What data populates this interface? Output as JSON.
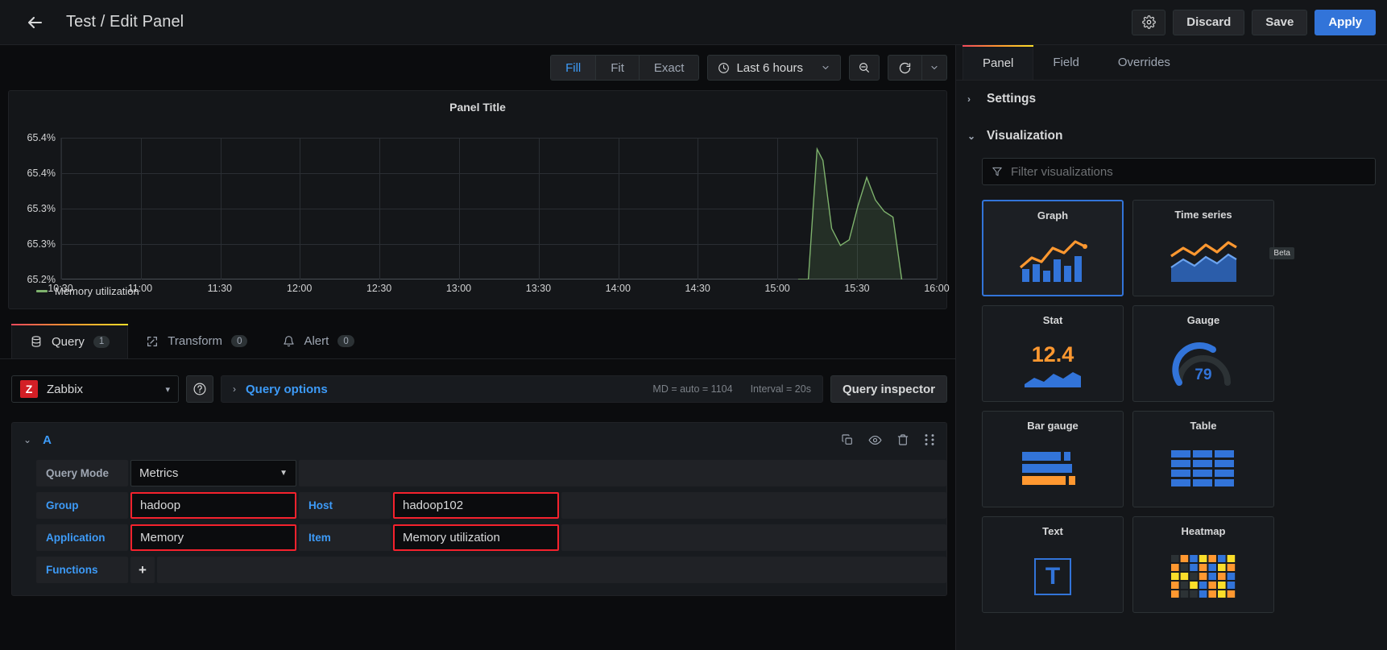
{
  "header": {
    "back_icon": "arrow-left-icon",
    "title": "Test / Edit Panel",
    "gear_icon": "gear-icon",
    "discard_label": "Discard",
    "save_label": "Save",
    "apply_label": "Apply"
  },
  "graph_toolbar": {
    "fit_modes": [
      {
        "label": "Fill",
        "active": true
      },
      {
        "label": "Fit",
        "active": false
      },
      {
        "label": "Exact",
        "active": false
      }
    ],
    "time_range": "Last 6 hours",
    "clock_icon": "clock-icon",
    "caret_icon": "chevron-down-icon",
    "zoom_out_icon": "zoom-out-icon",
    "refresh_icon": "refresh-icon",
    "refresh_caret_icon": "chevron-down-icon"
  },
  "chart_data": {
    "type": "area",
    "title": "Panel Title",
    "xlabel": "",
    "ylabel": "",
    "grid": true,
    "legend": [
      {
        "label": "Memory utilization",
        "color": "#7eb26d"
      }
    ],
    "y_ticks": [
      "65.2%",
      "65.3%",
      "65.3%",
      "65.4%",
      "65.4%"
    ],
    "ylim": [
      65.2,
      65.45
    ],
    "x_ticks": [
      "10:30",
      "11:00",
      "11:30",
      "12:00",
      "12:30",
      "13:00",
      "13:30",
      "14:00",
      "14:30",
      "15:00",
      "15:30",
      "16:00"
    ],
    "series": [
      {
        "name": "Memory utilization",
        "color": "#7eb26d",
        "x": [
          15.55,
          15.62,
          15.68,
          15.72,
          15.78,
          15.84,
          15.9,
          15.96,
          16.02,
          16.08,
          16.14,
          16.2,
          16.26
        ],
        "values": [
          65.2,
          65.2,
          65.43,
          65.41,
          65.29,
          65.26,
          65.27,
          65.33,
          65.38,
          65.34,
          65.32,
          65.31,
          65.2
        ]
      }
    ]
  },
  "query_tabs": [
    {
      "label": "Query",
      "badge": "1",
      "icon": "database-icon",
      "active": true
    },
    {
      "label": "Transform",
      "badge": "0",
      "icon": "transform-icon",
      "active": false
    },
    {
      "label": "Alert",
      "badge": "0",
      "icon": "bell-icon",
      "active": false
    }
  ],
  "datasource": {
    "logo_text": "Z",
    "name": "Zabbix",
    "caret_icon": "chevron-down-icon",
    "help_icon": "help-circle-icon",
    "query_options_label": "Query options",
    "query_options_caret": "chevron-right-icon",
    "max_data_points": "MD = auto = 1104",
    "interval": "Interval = 20s",
    "query_inspector_label": "Query inspector"
  },
  "query": {
    "ref_id": "A",
    "collapse_icon": "chevron-down-icon",
    "actions": [
      {
        "name": "duplicate-query-icon",
        "glyph": "copy"
      },
      {
        "name": "hide-response-icon",
        "glyph": "eye"
      },
      {
        "name": "remove-query-icon",
        "glyph": "trash"
      },
      {
        "name": "drag-handle-icon",
        "glyph": "grip"
      }
    ],
    "rows": [
      {
        "label": "Query Mode",
        "label_style": "muted",
        "value": "Metrics",
        "type": "select",
        "highlight": false
      },
      {
        "label": "Group",
        "label_style": "blue",
        "value": "hadoop",
        "type": "text",
        "highlight": true,
        "label2": "Host",
        "value2": "hadoop102",
        "highlight2": true
      },
      {
        "label": "Application",
        "label_style": "blue",
        "value": "Memory",
        "type": "text",
        "highlight": true,
        "label2": "Item",
        "value2": "Memory utilization",
        "highlight2": true
      },
      {
        "label": "Functions",
        "label_style": "blue",
        "value": "+",
        "type": "button",
        "highlight": false
      }
    ]
  },
  "options_pane": {
    "tabs": [
      {
        "label": "Panel",
        "active": true
      },
      {
        "label": "Field",
        "active": false
      },
      {
        "label": "Overrides",
        "active": false
      }
    ],
    "sections": [
      {
        "label": "Settings",
        "expanded": false
      },
      {
        "label": "Visualization",
        "expanded": true
      }
    ],
    "filter_placeholder": "Filter visualizations",
    "filter_icon": "filter-icon",
    "visualizations": [
      {
        "name": "Graph",
        "selected": true,
        "art": "graph"
      },
      {
        "name": "Time series",
        "selected": false,
        "art": "timeseries",
        "tag": "Beta"
      },
      {
        "name": "Stat",
        "selected": false,
        "art": "stat",
        "value": "12.4"
      },
      {
        "name": "Gauge",
        "selected": false,
        "art": "gauge",
        "value": "79"
      },
      {
        "name": "Bar gauge",
        "selected": false,
        "art": "bargauge"
      },
      {
        "name": "Table",
        "selected": false,
        "art": "table"
      },
      {
        "name": "Text",
        "selected": false,
        "art": "text",
        "value": "T"
      },
      {
        "name": "Heatmap",
        "selected": false,
        "art": "heatmap"
      }
    ]
  }
}
